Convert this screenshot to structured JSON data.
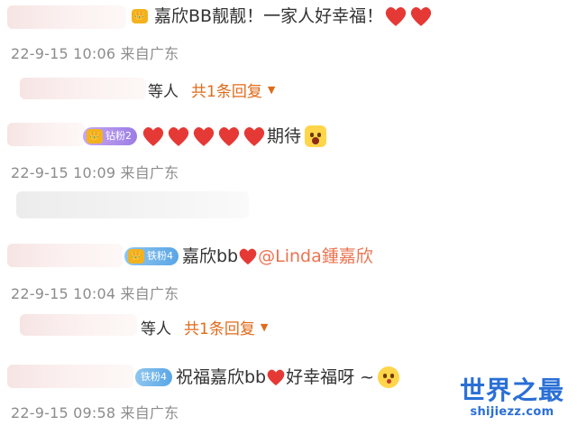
{
  "comments": [
    {
      "text": "嘉欣BB靓靓！一家人好幸福！",
      "meta": "22-9-15 10:06 来自广东"
    },
    {
      "reply_prefix": "等人",
      "reply_count": "共1条回复"
    },
    {
      "badge": "钻粉2",
      "text": "期待",
      "meta": "22-9-15 10:09 来自广东"
    },
    {
      "badge": "铁粉4",
      "text": "嘉欣bb",
      "mention": "@Linda鍾嘉欣",
      "meta": "22-9-15 10:04 来自广东"
    },
    {
      "reply_prefix": "等人",
      "reply_count": "共1条回复"
    },
    {
      "badge": "铁粉4",
      "text": "祝福嘉欣bb",
      "text_after": "好幸福呀 ~",
      "meta": "22-9-15 09:58 来自广东"
    }
  ],
  "watermark": {
    "title": "世界之最",
    "url": "shijiezz.com"
  },
  "colors": {
    "heart": "#e53935",
    "reply_accent": "#e06a1a",
    "mention": "#eb7350",
    "watermark": "#2a6fd6"
  },
  "icons": [
    "heart-icon",
    "crown-badge-icon",
    "kiss-emoji-icon",
    "wow-emoji-icon",
    "dropdown-caret-icon"
  ]
}
